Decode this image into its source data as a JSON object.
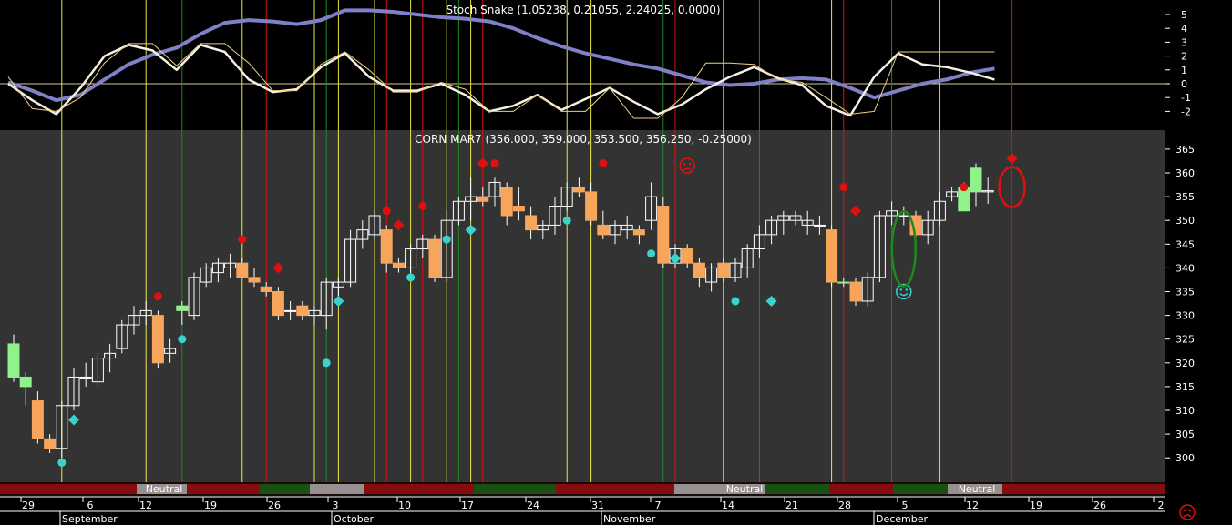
{
  "indicator_title": "Stoch Snake (1.05238, 0.21055, 2.24025, 0.0000)",
  "price_title": "CORN MAR7 (356.000, 359.000, 353.500, 356.250, -0.25000)",
  "band_label": "Neutral",
  "band_labels": [
    "Neutral",
    "Neutral",
    "Neutral"
  ],
  "colors": {
    "up": "#8ff28a",
    "down": "#f7a55a",
    "bg_top": "#000000",
    "bg_price": "#333333",
    "slow": "#8080c8",
    "fast": "#f5f0e6",
    "signal": "#f0d080",
    "buy": "#3cd2cc",
    "sell": "#e01010"
  },
  "x_axis": {
    "days": [
      "29",
      "6",
      "12",
      "19",
      "26",
      "3",
      "10",
      "17",
      "24",
      "31",
      "7",
      "14",
      "21",
      "28",
      "5",
      "12",
      "19",
      "26",
      "2"
    ],
    "months": [
      "September",
      "October",
      "November",
      "December"
    ]
  },
  "chart_data": [
    {
      "type": "line",
      "title": "Stoch Snake (1.05238, 0.21055, 2.24025, 0.0000)",
      "ylim": [
        -3,
        6
      ],
      "yticks": [
        5,
        4,
        3,
        2,
        1,
        0,
        -1,
        -2
      ],
      "series": [
        {
          "key": "slow",
          "x": [
            0,
            2,
            4,
            6,
            8,
            10,
            12,
            14,
            16,
            18,
            20,
            22,
            24,
            26,
            28,
            30,
            32,
            34,
            36,
            38,
            40,
            42,
            44,
            46,
            48,
            50,
            52,
            54,
            56,
            58,
            60,
            62,
            64,
            66,
            68,
            70,
            72,
            74,
            76,
            78,
            80,
            82
          ],
          "values": [
            0.1,
            -0.5,
            -1.2,
            -0.8,
            0.3,
            1.4,
            2.1,
            2.6,
            3.6,
            4.4,
            4.6,
            4.5,
            4.3,
            4.6,
            5.3,
            5.3,
            5.2,
            5.0,
            4.8,
            4.7,
            4.5,
            4.0,
            3.3,
            2.7,
            2.2,
            1.8,
            1.4,
            1.1,
            0.6,
            0.1,
            -0.1,
            0.0,
            0.3,
            0.4,
            0.3,
            -0.3,
            -1.0,
            -0.5,
            0.0,
            0.3,
            0.8,
            1.1
          ]
        },
        {
          "key": "fast",
          "x": [
            0,
            2,
            4,
            6,
            8,
            10,
            12,
            14,
            16,
            18,
            20,
            22,
            24,
            26,
            28,
            30,
            32,
            34,
            36,
            38,
            40,
            42,
            44,
            46,
            48,
            50,
            52,
            54,
            56,
            58,
            60,
            62,
            64,
            66,
            68,
            70,
            72,
            74,
            76,
            78,
            80,
            82
          ],
          "values": [
            0.0,
            -1.2,
            -2.2,
            -0.3,
            2.0,
            2.8,
            2.4,
            1.0,
            2.8,
            2.3,
            0.3,
            -0.6,
            -0.4,
            1.2,
            2.2,
            0.5,
            -0.5,
            -0.5,
            0.0,
            -0.8,
            -2.0,
            -1.6,
            -0.8,
            -1.9,
            -1.1,
            -0.3,
            -1.3,
            -2.2,
            -1.5,
            -0.4,
            0.5,
            1.2,
            0.4,
            -0.1,
            -1.6,
            -2.3,
            0.5,
            2.2,
            1.4,
            1.2,
            0.8,
            0.3
          ]
        },
        {
          "key": "signal",
          "x": [
            0,
            2,
            4,
            6,
            8,
            10,
            12,
            14,
            16,
            18,
            20,
            22,
            24,
            26,
            28,
            30,
            32,
            34,
            36,
            38,
            40,
            42,
            44,
            46,
            48,
            50,
            52,
            54,
            56,
            58,
            60,
            62,
            64,
            66,
            68,
            70,
            72,
            74,
            76,
            78,
            80,
            82
          ],
          "values": [
            0.5,
            -1.8,
            -2.0,
            -1.0,
            1.5,
            2.9,
            2.9,
            1.3,
            2.9,
            2.9,
            1.5,
            -0.5,
            -0.5,
            1.4,
            2.3,
            1.0,
            -0.6,
            -0.6,
            0.1,
            -0.4,
            -2.0,
            -2.0,
            -0.8,
            -2.0,
            -2.0,
            -0.3,
            -2.5,
            -2.5,
            -1.0,
            1.5,
            1.5,
            1.4,
            0.3,
            0.1,
            -1.0,
            -2.2,
            -2.0,
            2.3,
            2.3,
            2.3,
            2.3,
            2.3
          ]
        }
      ]
    },
    {
      "type": "candlestick",
      "title": "CORN MAR7 (356.000, 359.000, 353.500, 356.250, -0.25000)",
      "ylim": [
        296,
        369
      ],
      "yticks": [
        365,
        360,
        355,
        350,
        345,
        340,
        335,
        330,
        325,
        320,
        315,
        310,
        305,
        300
      ],
      "candles": [
        {
          "o": 317,
          "h": 326,
          "l": 316,
          "c": 324,
          "u": "f"
        },
        {
          "o": 315,
          "h": 318,
          "l": 311,
          "c": 317,
          "u": "f"
        },
        {
          "o": 312,
          "h": 314,
          "l": 303,
          "c": 304,
          "u": "f"
        },
        {
          "o": 304,
          "h": 305,
          "l": 301,
          "c": 302,
          "u": "f"
        },
        {
          "o": 302,
          "h": 312,
          "l": 300,
          "c": 311,
          "u": "h"
        },
        {
          "o": 311,
          "h": 319,
          "l": 310,
          "c": 317,
          "u": "h"
        },
        {
          "o": 317,
          "h": 320,
          "l": 315,
          "c": 317,
          "u": "h"
        },
        {
          "o": 316,
          "h": 322,
          "l": 315,
          "c": 321,
          "u": "h"
        },
        {
          "o": 321,
          "h": 324,
          "l": 318,
          "c": 322,
          "u": "h"
        },
        {
          "o": 323,
          "h": 329,
          "l": 322,
          "c": 328,
          "u": "h"
        },
        {
          "o": 328,
          "h": 332,
          "l": 326,
          "c": 330,
          "u": "h"
        },
        {
          "o": 330,
          "h": 333,
          "l": 328,
          "c": 331,
          "u": "h"
        },
        {
          "o": 330,
          "h": 331,
          "l": 319,
          "c": 320,
          "u": "f"
        },
        {
          "o": 322,
          "h": 325,
          "l": 320,
          "c": 323,
          "u": "h"
        },
        {
          "o": 331,
          "h": 333,
          "l": 328,
          "c": 332,
          "u": "f"
        },
        {
          "o": 330,
          "h": 339,
          "l": 329,
          "c": 338,
          "u": "h"
        },
        {
          "o": 337,
          "h": 341,
          "l": 336,
          "c": 340,
          "u": "h"
        },
        {
          "o": 339,
          "h": 342,
          "l": 337,
          "c": 341,
          "u": "h"
        },
        {
          "o": 340,
          "h": 343,
          "l": 338,
          "c": 341,
          "u": "h"
        },
        {
          "o": 341,
          "h": 342,
          "l": 338,
          "c": 338,
          "u": "f"
        },
        {
          "o": 338,
          "h": 340,
          "l": 336,
          "c": 337,
          "u": "f"
        },
        {
          "o": 336,
          "h": 337,
          "l": 334,
          "c": 335,
          "u": "f"
        },
        {
          "o": 335,
          "h": 336,
          "l": 329,
          "c": 330,
          "u": "f"
        },
        {
          "o": 331,
          "h": 333,
          "l": 329,
          "c": 331,
          "u": "h"
        },
        {
          "o": 332,
          "h": 333,
          "l": 329,
          "c": 330,
          "u": "f"
        },
        {
          "o": 330,
          "h": 332,
          "l": 328,
          "c": 331,
          "u": "h"
        },
        {
          "o": 330,
          "h": 338,
          "l": 327,
          "c": 337,
          "u": "h"
        },
        {
          "o": 336,
          "h": 338,
          "l": 333,
          "c": 337,
          "u": "h"
        },
        {
          "o": 337,
          "h": 348,
          "l": 336,
          "c": 346,
          "u": "h"
        },
        {
          "o": 346,
          "h": 350,
          "l": 344,
          "c": 348,
          "u": "h"
        },
        {
          "o": 347,
          "h": 352,
          "l": 346,
          "c": 351,
          "u": "h"
        },
        {
          "o": 348,
          "h": 349,
          "l": 339,
          "c": 341,
          "u": "f"
        },
        {
          "o": 341,
          "h": 342,
          "l": 339,
          "c": 340,
          "u": "f"
        },
        {
          "o": 340,
          "h": 345,
          "l": 339,
          "c": 344,
          "u": "h"
        },
        {
          "o": 344,
          "h": 347,
          "l": 342,
          "c": 346,
          "u": "h"
        },
        {
          "o": 346,
          "h": 347,
          "l": 337,
          "c": 338,
          "u": "f"
        },
        {
          "o": 338,
          "h": 352,
          "l": 337,
          "c": 350,
          "u": "h"
        },
        {
          "o": 350,
          "h": 355,
          "l": 349,
          "c": 354,
          "u": "h"
        },
        {
          "o": 354,
          "h": 359,
          "l": 350,
          "c": 355,
          "u": "h"
        },
        {
          "o": 355,
          "h": 357,
          "l": 353,
          "c": 354,
          "u": "f"
        },
        {
          "o": 355,
          "h": 359,
          "l": 353,
          "c": 358,
          "u": "h"
        },
        {
          "o": 357,
          "h": 358,
          "l": 349,
          "c": 351,
          "u": "f"
        },
        {
          "o": 353,
          "h": 357,
          "l": 350,
          "c": 352,
          "u": "f"
        },
        {
          "o": 351,
          "h": 353,
          "l": 346,
          "c": 348,
          "u": "f"
        },
        {
          "o": 348,
          "h": 350,
          "l": 346,
          "c": 349,
          "u": "h"
        },
        {
          "o": 349,
          "h": 355,
          "l": 347,
          "c": 353,
          "u": "h"
        },
        {
          "o": 353,
          "h": 358,
          "l": 352,
          "c": 357,
          "u": "h"
        },
        {
          "o": 357,
          "h": 359,
          "l": 355,
          "c": 356,
          "u": "f"
        },
        {
          "o": 356,
          "h": 358,
          "l": 349,
          "c": 350,
          "u": "f"
        },
        {
          "o": 349,
          "h": 352,
          "l": 346,
          "c": 347,
          "u": "f"
        },
        {
          "o": 347,
          "h": 350,
          "l": 345,
          "c": 349,
          "u": "h"
        },
        {
          "o": 348,
          "h": 351,
          "l": 346,
          "c": 349,
          "u": "h"
        },
        {
          "o": 348,
          "h": 349,
          "l": 345,
          "c": 347,
          "u": "f"
        },
        {
          "o": 350,
          "h": 358,
          "l": 348,
          "c": 355,
          "u": "h"
        },
        {
          "o": 353,
          "h": 355,
          "l": 340,
          "c": 341,
          "u": "f"
        },
        {
          "o": 341,
          "h": 345,
          "l": 340,
          "c": 344,
          "u": "h"
        },
        {
          "o": 344,
          "h": 345,
          "l": 340,
          "c": 341,
          "u": "f"
        },
        {
          "o": 341,
          "h": 342,
          "l": 336,
          "c": 338,
          "u": "f"
        },
        {
          "o": 337,
          "h": 341,
          "l": 335,
          "c": 340,
          "u": "h"
        },
        {
          "o": 341,
          "h": 342,
          "l": 337,
          "c": 338,
          "u": "f"
        },
        {
          "o": 338,
          "h": 342,
          "l": 337,
          "c": 341,
          "u": "h"
        },
        {
          "o": 340,
          "h": 345,
          "l": 338,
          "c": 344,
          "u": "h"
        },
        {
          "o": 344,
          "h": 349,
          "l": 342,
          "c": 347,
          "u": "h"
        },
        {
          "o": 347,
          "h": 351,
          "l": 345,
          "c": 350,
          "u": "h"
        },
        {
          "o": 350,
          "h": 352,
          "l": 347,
          "c": 351,
          "u": "h"
        },
        {
          "o": 350,
          "h": 352,
          "l": 349,
          "c": 351,
          "u": "h"
        },
        {
          "o": 349,
          "h": 352,
          "l": 347,
          "c": 350,
          "u": "h"
        },
        {
          "o": 349,
          "h": 351,
          "l": 347,
          "c": 349,
          "u": "h"
        },
        {
          "o": 348,
          "h": 349,
          "l": 336,
          "c": 337,
          "u": "f"
        },
        {
          "o": 337,
          "h": 338,
          "l": 336,
          "c": 337,
          "u": "f"
        },
        {
          "o": 337,
          "h": 338,
          "l": 332,
          "c": 333,
          "u": "f"
        },
        {
          "o": 333,
          "h": 339,
          "l": 332,
          "c": 338,
          "u": "h"
        },
        {
          "o": 338,
          "h": 352,
          "l": 337,
          "c": 351,
          "u": "h"
        },
        {
          "o": 351,
          "h": 354,
          "l": 349,
          "c": 352,
          "u": "h"
        },
        {
          "o": 351,
          "h": 353,
          "l": 349,
          "c": 351,
          "u": "h"
        },
        {
          "o": 351,
          "h": 352,
          "l": 346,
          "c": 347,
          "u": "f"
        },
        {
          "o": 347,
          "h": 352,
          "l": 345,
          "c": 350,
          "u": "h"
        },
        {
          "o": 350,
          "h": 356,
          "l": 349,
          "c": 354,
          "u": "h"
        },
        {
          "o": 355,
          "h": 357,
          "l": 354,
          "c": 356,
          "u": "h"
        },
        {
          "o": 352,
          "h": 358,
          "l": 352,
          "c": 357,
          "u": "f"
        },
        {
          "o": 356,
          "h": 362,
          "l": 353,
          "c": 361,
          "u": "f"
        },
        {
          "o": 356,
          "h": 359,
          "l": 353.5,
          "c": 356.25,
          "u": "h"
        }
      ]
    }
  ]
}
